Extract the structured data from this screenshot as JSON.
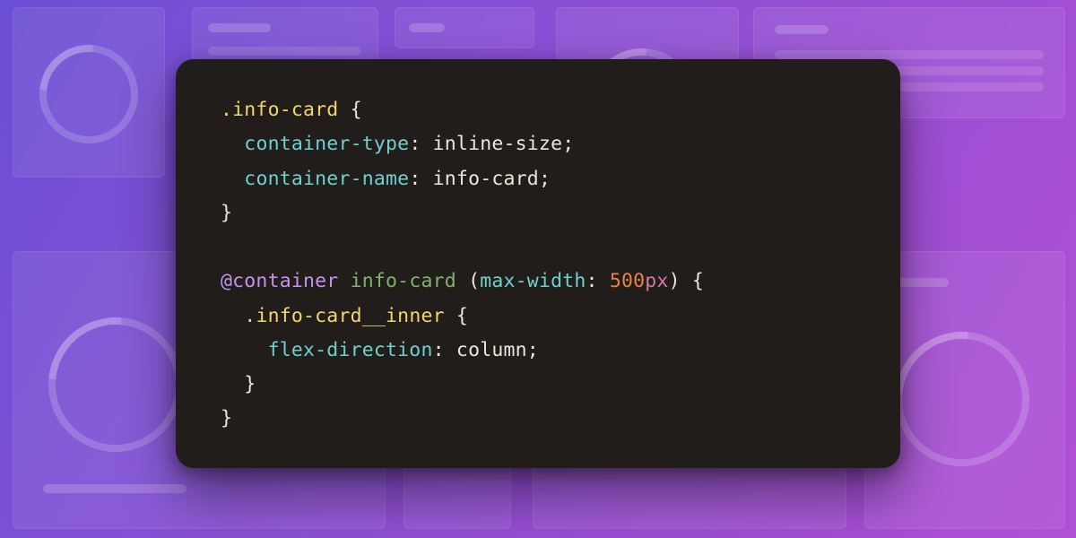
{
  "code": {
    "rule1": {
      "selector": ".info-card",
      "open": "{",
      "close": "}",
      "decl1_prop": "container-type",
      "decl1_val": "inline-size",
      "decl2_prop": "container-name",
      "decl2_val": "info-card"
    },
    "at": {
      "keyword": "@container",
      "name": "info-card",
      "paren_open": "(",
      "cond_key": "max-width",
      "colon": ":",
      "num": "500",
      "unit": "px",
      "paren_close": ")",
      "open": "{",
      "close": "}"
    },
    "rule2": {
      "selector": ".info-card__inner",
      "open": "{",
      "close": "}",
      "decl1_prop": "flex-direction",
      "decl1_val": "column"
    },
    "punct": {
      "colon": ":",
      "semi": ";",
      "space": " "
    }
  },
  "colors": {
    "bg_gradient_from": "#6a4fd4",
    "bg_gradient_to": "#b04fd4",
    "panel_bg": "#201d1b",
    "selector": "#f3d66b",
    "property": "#6fd0cf",
    "at_rule": "#c792ea",
    "container_name": "#7fb46a",
    "number": "#e7814d",
    "unit": "#d07aa8"
  }
}
